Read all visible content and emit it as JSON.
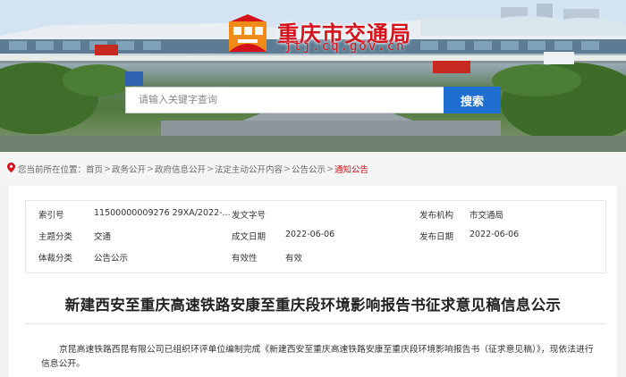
{
  "header": {
    "site_title": "重庆市交通局",
    "site_domain": "jtj.cq.gov.cn",
    "search_placeholder": "请输入关键字查询",
    "search_button": "搜索"
  },
  "breadcrumb": {
    "prefix": "您当前所在位置：",
    "items": [
      "首页",
      "政务公开",
      "政府信息公开",
      "法定主动公开内容",
      "公告公示"
    ],
    "current": "通知公告",
    "separator": ">"
  },
  "meta": {
    "index_label": "索引号",
    "index_value": "11500000009276 29XA/2022-...",
    "doc_no_label": "发文字号",
    "doc_no_value": "",
    "agency_label": "发布机构",
    "agency_value": "市交通局",
    "topic_label": "主题分类",
    "topic_value": "交通",
    "created_label": "成文日期",
    "created_value": "2022-06-06",
    "published_label": "发布日期",
    "published_value": "2022-06-06",
    "genre_label": "体裁分类",
    "genre_value": "公告公示",
    "validity_label": "有效性",
    "validity_value": "有效"
  },
  "article": {
    "title": "新建西安至重庆高速铁路安康至重庆段环境影响报告书征求意见稿信息公示",
    "body": "京昆高速铁路西昆有限公司已组织环评单位编制完成《新建西安至重庆高速铁路安康至重庆段环境影响报告书（征求意见稿）》，现依法进行信息公开。"
  },
  "colors": {
    "brand_red": "#d4121c",
    "search_blue": "#1f6fd1"
  }
}
